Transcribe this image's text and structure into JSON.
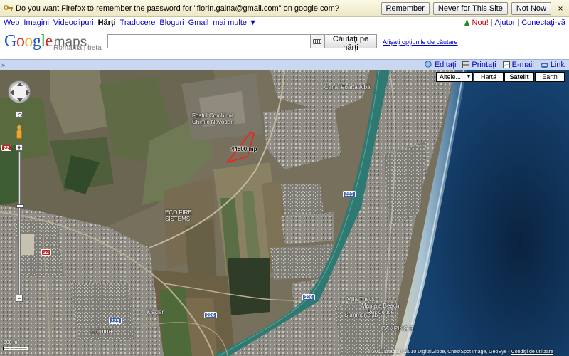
{
  "password_bar": {
    "message": "Do you want Firefox to remember the password for \"florin.gaina@gmail.com\" on google.com?",
    "remember_label": "Remember",
    "never_label": "Never for This Site",
    "not_now_label": "Not Now",
    "close_label": "×",
    "icon": "key-icon"
  },
  "nav": {
    "items": [
      {
        "label": "Web",
        "current": false
      },
      {
        "label": "Imagini",
        "current": false
      },
      {
        "label": "Videoclipuri",
        "current": false
      },
      {
        "label": "Hărţi",
        "current": true
      },
      {
        "label": "Traducere",
        "current": false
      },
      {
        "label": "Bloguri",
        "current": false
      },
      {
        "label": "Gmail",
        "current": false
      },
      {
        "label": "mai multe ▼",
        "current": false
      }
    ],
    "user": {
      "new_label": "Nou!",
      "help_label": "Ajutor",
      "login_label": "Conectaţi-vă",
      "separator": "|"
    }
  },
  "header": {
    "logo_google": "Google",
    "logo_maps": "maps",
    "logo_subtitle": "România | beta",
    "search_value": "",
    "search_button": "Căutaţi pe hărţi",
    "search_options": "Afişaţi opţiunile de căutare"
  },
  "toolbar": {
    "collapse": "»",
    "edit": "Editaţi",
    "print": "Printaţi",
    "email": "E-mail",
    "link": "Link"
  },
  "map": {
    "types": {
      "other": "Altele...",
      "map": "Hartă",
      "satellite": "Satelit",
      "earth": "Earth",
      "active": "satellite"
    },
    "labels": {
      "combinat": "Fostul Combinat",
      "combinat2": "Chimic Navodari",
      "area": "44500 mp",
      "eco": "ECO FIRE",
      "eco2": "SISTEMS",
      "lumina": "Lumina",
      "kiskler": "Kiskler",
      "villa": "Villa Thetis",
      "summer": "Summer club",
      "mamaia": "Mamaia Beach",
      "residence": "Residence",
      "camping": "CAMPING S",
      "canal": "Canal Poarta Albă"
    },
    "shields": {
      "r22a": "22",
      "r22b": "22",
      "b226a": "226",
      "b226b": "226",
      "b226c": "226",
      "b226d": "226"
    },
    "scale": "500 m",
    "powered": "©2010 Google",
    "copyright": "Imagini ©2010 DigitalGlobe, Cnes/Spot Image, GeoEye",
    "terms": "Condiţii de utilizare",
    "colors": {
      "sea": "#0d2a4d",
      "canal": "#2b6e6a",
      "field": "#7b7460",
      "urban": "#8d8a84",
      "area_outline": "#ff1a1a"
    }
  }
}
